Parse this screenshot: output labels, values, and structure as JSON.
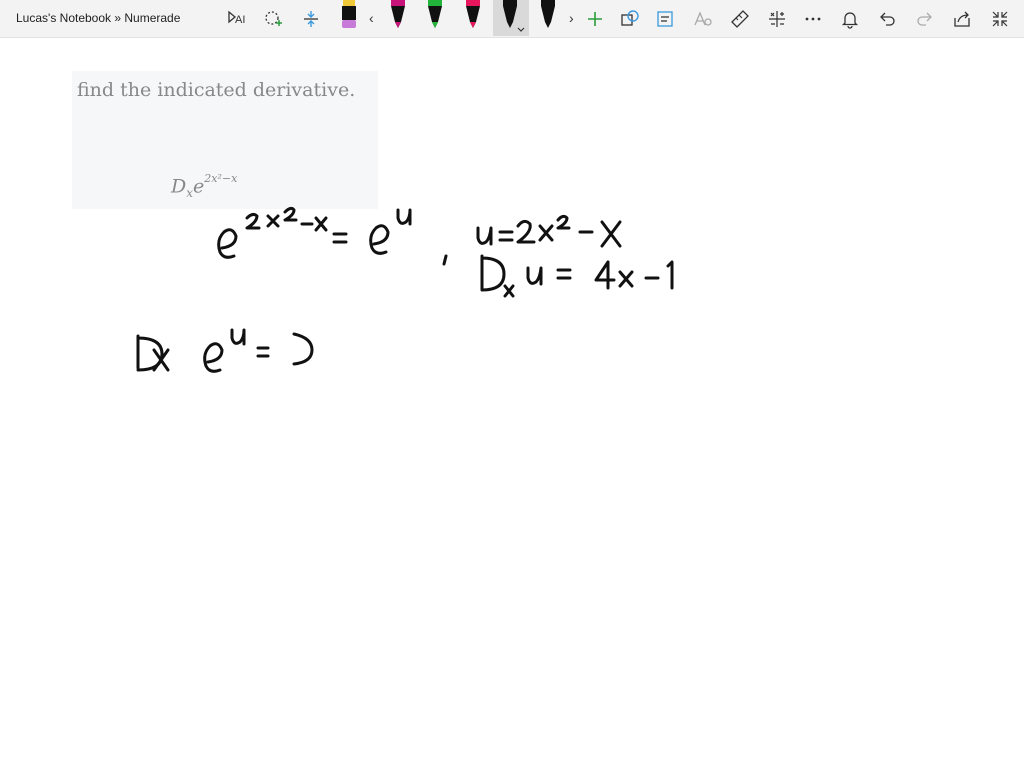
{
  "window": {
    "title": "Lucas's Notebook » Numerade"
  },
  "toolbar": {
    "icons": [
      "text-select-icon",
      "lasso-select-icon",
      "insert-space-icon",
      "highlighter-icon",
      "chevron-left-icon",
      "pen-magenta-icon",
      "pen-green-icon",
      "pen-pink-icon",
      "pen-black-selected-icon",
      "pen-black-icon",
      "chevron-right-icon",
      "add-pen-icon",
      "ink-to-shape-icon",
      "ink-to-text-icon",
      "ink-to-math-icon",
      "ruler-icon",
      "math-tool-icon",
      "more-icon",
      "notification-icon",
      "undo-icon",
      "redo-icon",
      "share-icon",
      "fullscreen-icon"
    ],
    "colors": {
      "highlighter": "#f0c93a",
      "magenta": "#c8147a",
      "green": "#22b33a",
      "pink": "#e8175d",
      "black": "#111111",
      "accent": "#3a9ae0"
    }
  },
  "problem": {
    "instruction": "find the indicated derivative.",
    "expr_base": "D",
    "expr_sub": "x",
    "expr_e": "e",
    "expr_sup": "2x²−x"
  }
}
